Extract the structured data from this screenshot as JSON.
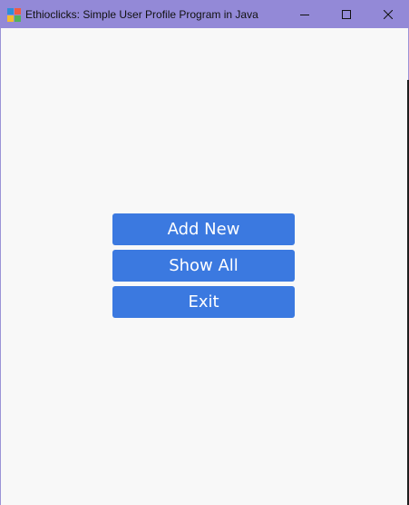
{
  "window": {
    "title": "Ethioclicks: Simple User Profile Program in Java",
    "icons": {
      "app": "app-icon",
      "minimize": "minimize-icon",
      "maximize": "maximize-icon",
      "close": "close-icon"
    }
  },
  "menu": {
    "add_new_label": "Add New",
    "show_all_label": "Show All",
    "exit_label": "Exit"
  },
  "colors": {
    "titlebar": "#9389d7",
    "button": "#3b79e0",
    "button_text": "#ffffff",
    "background": "#f8f8f8"
  }
}
